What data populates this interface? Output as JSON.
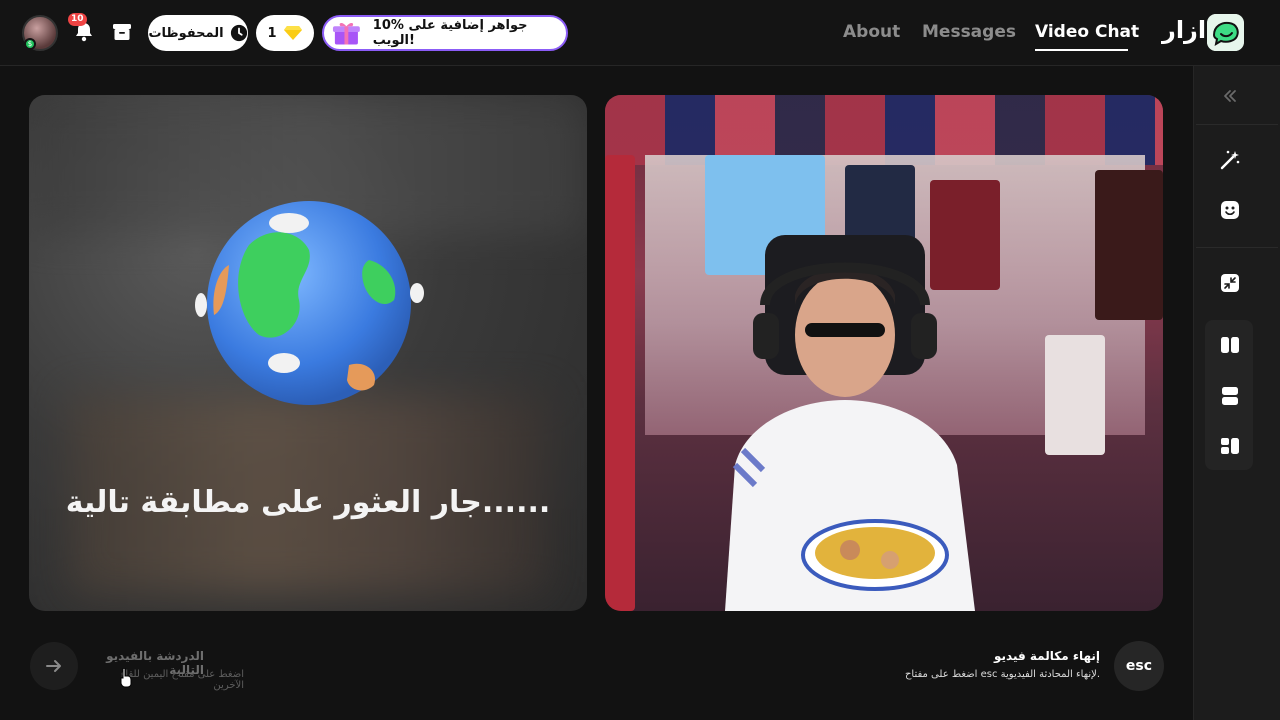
{
  "header": {
    "brand": "ازار",
    "nav": {
      "about": "About",
      "messages": "Messages",
      "video_chat": "Video Chat"
    },
    "notifications_count": "10",
    "avatar_badge": "$",
    "saved_label": "المحفوظات",
    "gems_count": "1",
    "promo_text": "10% جواهر إضافية على الويب!"
  },
  "main": {
    "search_status": "جار العثور على مطابقة تالية......",
    "next_chat": {
      "title": "الدردشة بالفيديو التالية",
      "subtitle": "اضغط على مفتاح اليمين للقاء الآخرين"
    },
    "end_call": {
      "key": "esc",
      "title": "إنهاء مكالمة فيديو",
      "subtitle": "اضغط على مفتاح esc لإنهاء المحادثة الفيديوية."
    }
  },
  "sidebar": {
    "icons": [
      "collapse-icon",
      "magic-wand-icon",
      "face-icon",
      "minimize-icon",
      "layout-split-vertical-icon",
      "layout-split-horizontal-icon",
      "layout-grid-icon"
    ]
  },
  "colors": {
    "accent_purple": "#8b5cf6",
    "badge_red": "#ef4444",
    "brand_green": "#22c55e"
  }
}
